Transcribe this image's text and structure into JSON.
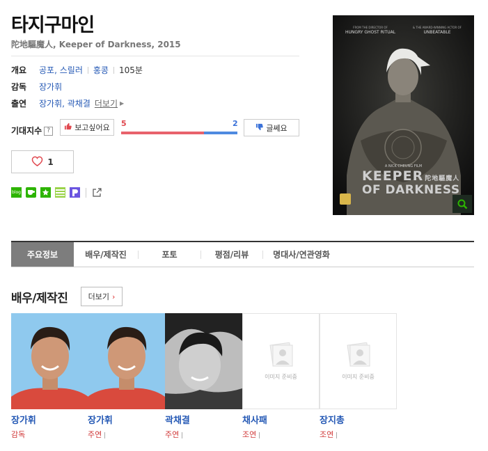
{
  "movie": {
    "title": "타지구마인",
    "subtitle": "陀地驅魔人, Keeper of Darkness, 2015"
  },
  "info": {
    "overview_label": "개요",
    "genres": [
      "공포",
      "스릴러"
    ],
    "country": "홍콩",
    "runtime": "105분",
    "director_label": "감독",
    "director": "장가휘",
    "cast_label": "출연",
    "cast": "장가휘, 곽채결",
    "more_label": "더보기"
  },
  "expectation": {
    "label": "기대지수",
    "help": "?",
    "want_label": "보고싶어요",
    "meh_label": "글쎄요",
    "want_count": "5",
    "meh_count": "2",
    "want_ratio": 0.714,
    "colors": {
      "want": "#e8626c",
      "meh": "#4e8ae0"
    }
  },
  "like": {
    "count": "1"
  },
  "share_icons": [
    "blog-icon",
    "cafe-icon",
    "bookmark-star-icon",
    "memo-icon",
    "band-icon",
    "share-icon"
  ],
  "poster": {
    "top_left": "FROM THE DIRECTOR OF",
    "top_left_title": "HUNGRY GHOST RITUAL",
    "top_right": "& THE AWARD-WINNING ACTOR OF",
    "top_right_title": "UNBEATABLE",
    "credit": "A NICK CHEUNG FILM",
    "title_line1": "KEEPER",
    "title_cn": "陀地驅魔人",
    "title_line2": "OF DARKNESS"
  },
  "tabs": [
    "주요정보",
    "배우/제작진",
    "포토",
    "평점/리뷰",
    "명대사/연관영화"
  ],
  "section": {
    "title": "배우/제작진",
    "more": "더보기"
  },
  "people": [
    {
      "name": "장가휘",
      "role": "감독"
    },
    {
      "name": "장가휘",
      "role": "주연"
    },
    {
      "name": "곽채결",
      "role": "주연"
    },
    {
      "name": "채사패",
      "role": "조연"
    },
    {
      "name": "장지총",
      "role": "조연"
    }
  ],
  "placeholder_text": "이미지 준비중"
}
